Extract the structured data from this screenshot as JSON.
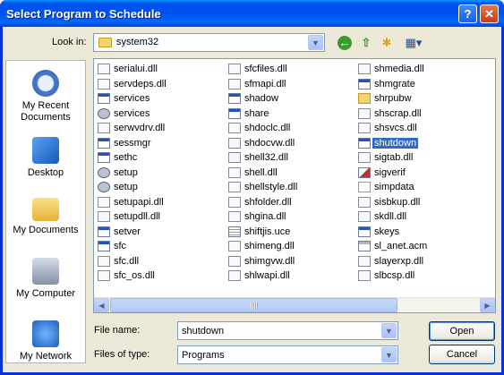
{
  "dialog": {
    "title": "Select Program to Schedule",
    "help_glyph": "?",
    "close_glyph": "✕"
  },
  "toolbar": {
    "lookin_label": "Look in:",
    "lookin_value": "system32"
  },
  "places": [
    {
      "label": "My Recent Documents",
      "icon": "recent-documents-icon"
    },
    {
      "label": "Desktop",
      "icon": "desktop-icon"
    },
    {
      "label": "My Documents",
      "icon": "my-documents-icon"
    },
    {
      "label": "My Computer",
      "icon": "my-computer-icon"
    },
    {
      "label": "My Network",
      "icon": "network-icon"
    }
  ],
  "files": {
    "col1": [
      {
        "name": "serialui.dll",
        "icon": "dll"
      },
      {
        "name": "servdeps.dll",
        "icon": "dll"
      },
      {
        "name": "services",
        "icon": "exe"
      },
      {
        "name": "services",
        "icon": "gear"
      },
      {
        "name": "serwvdrv.dll",
        "icon": "dll"
      },
      {
        "name": "sessmgr",
        "icon": "exe"
      },
      {
        "name": "sethc",
        "icon": "exe"
      },
      {
        "name": "setup",
        "icon": "gear"
      },
      {
        "name": "setup",
        "icon": "gear"
      },
      {
        "name": "setupapi.dll",
        "icon": "dll"
      },
      {
        "name": "setupdll.dll",
        "icon": "dll"
      },
      {
        "name": "setver",
        "icon": "exe"
      },
      {
        "name": "sfc",
        "icon": "exe"
      },
      {
        "name": "sfc.dll",
        "icon": "dll"
      },
      {
        "name": "sfc_os.dll",
        "icon": "dll"
      }
    ],
    "col2": [
      {
        "name": "sfcfiles.dll",
        "icon": "dll"
      },
      {
        "name": "sfmapi.dll",
        "icon": "dll"
      },
      {
        "name": "shadow",
        "icon": "exe"
      },
      {
        "name": "share",
        "icon": "exe"
      },
      {
        "name": "shdoclc.dll",
        "icon": "dll"
      },
      {
        "name": "shdocvw.dll",
        "icon": "dll"
      },
      {
        "name": "shell32.dll",
        "icon": "dll"
      },
      {
        "name": "shell.dll",
        "icon": "dll"
      },
      {
        "name": "shellstyle.dll",
        "icon": "dll"
      },
      {
        "name": "shfolder.dll",
        "icon": "dll"
      },
      {
        "name": "shgina.dll",
        "icon": "dll"
      },
      {
        "name": "shiftjis.uce",
        "icon": "ucf"
      },
      {
        "name": "shimeng.dll",
        "icon": "dll"
      },
      {
        "name": "shimgvw.dll",
        "icon": "dll"
      },
      {
        "name": "shlwapi.dll",
        "icon": "dll"
      }
    ],
    "col3": [
      {
        "name": "shmedia.dll",
        "icon": "dll"
      },
      {
        "name": "shmgrate",
        "icon": "exe"
      },
      {
        "name": "shrpubw",
        "icon": "fold"
      },
      {
        "name": "shscrap.dll",
        "icon": "dll"
      },
      {
        "name": "shsvcs.dll",
        "icon": "dll"
      },
      {
        "name": "shutdown",
        "icon": "exe",
        "selected": true
      },
      {
        "name": "sigtab.dll",
        "icon": "dll"
      },
      {
        "name": "sigverif",
        "icon": "cert"
      },
      {
        "name": "simpdata",
        "icon": "txt"
      },
      {
        "name": "sisbkup.dll",
        "icon": "dll"
      },
      {
        "name": "skdll.dll",
        "icon": "dll"
      },
      {
        "name": "skeys",
        "icon": "exe"
      },
      {
        "name": "sl_anet.acm",
        "icon": "sys"
      },
      {
        "name": "slayerxp.dll",
        "icon": "dll"
      },
      {
        "name": "slbcsp.dll",
        "icon": "dll"
      }
    ]
  },
  "form": {
    "filename_label": "File name:",
    "filename_value": "shutdown",
    "filetype_label": "Files of type:",
    "filetype_value": "Programs",
    "open_label": "Open",
    "cancel_label": "Cancel"
  },
  "colors": {
    "titlebar": "#0053ee",
    "dialog_bg": "#ece9d8",
    "selection": "#316ac5"
  }
}
